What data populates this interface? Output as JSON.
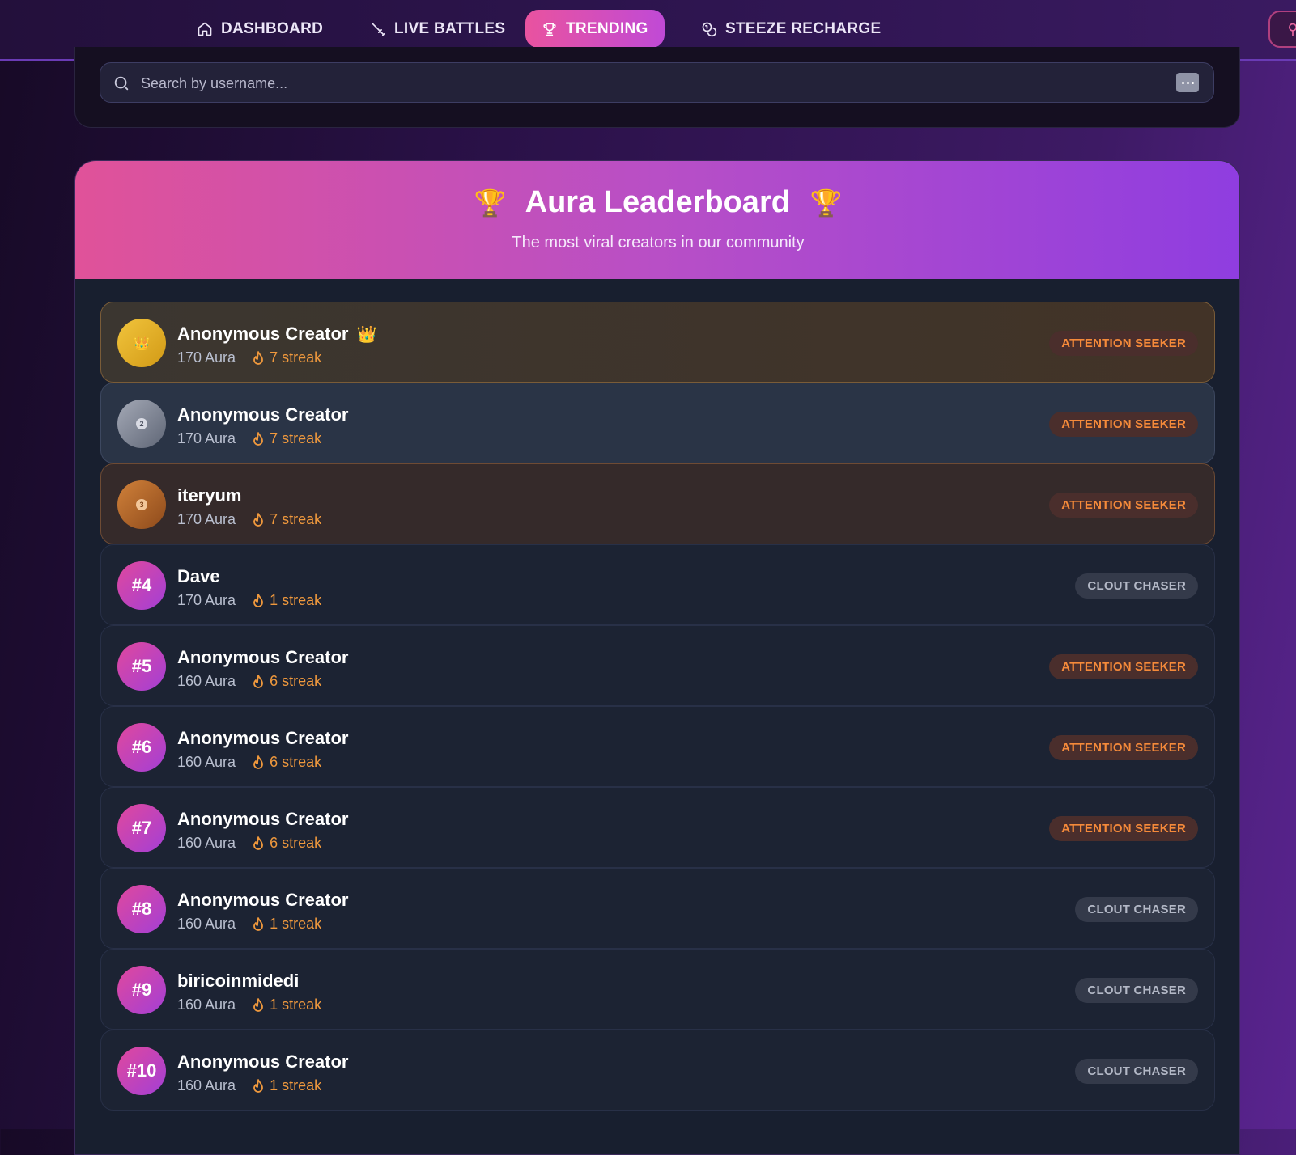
{
  "nav": {
    "items": [
      {
        "label": "DASHBOARD",
        "icon": "home-icon"
      },
      {
        "label": "LIVE BATTLES",
        "icon": "sword-icon"
      },
      {
        "label": "TRENDING",
        "icon": "trophy-icon",
        "active": true
      },
      {
        "label": "STEEZE RECHARGE",
        "icon": "coins-icon"
      }
    ]
  },
  "search": {
    "placeholder": "Search by username...",
    "value": ""
  },
  "leaderboard": {
    "title": "Aura Leaderboard",
    "trophy": "🏆",
    "subtitle": "The most viral creators in our community",
    "colors": {
      "header_start": "#e05299",
      "header_end": "#8f3de0",
      "attention_badge": "#f58a3a",
      "clout_badge": "#b3b8c6",
      "streak": "#f0993d"
    },
    "entries": [
      {
        "rank_label": "👑",
        "rank": 1,
        "name": "Anonymous Creator",
        "crown": "👑",
        "aura": "170 Aura",
        "streak": "7 streak",
        "badge": "ATTENTION SEEKER"
      },
      {
        "rank_label": "2",
        "rank": 2,
        "name": "Anonymous Creator",
        "aura": "170 Aura",
        "streak": "7 streak",
        "badge": "ATTENTION SEEKER"
      },
      {
        "rank_label": "3",
        "rank": 3,
        "name": "iteryum",
        "aura": "170 Aura",
        "streak": "7 streak",
        "badge": "ATTENTION SEEKER"
      },
      {
        "rank_label": "#4",
        "rank": 4,
        "name": "Dave",
        "aura": "170 Aura",
        "streak": "1 streak",
        "badge": "CLOUT CHASER"
      },
      {
        "rank_label": "#5",
        "rank": 5,
        "name": "Anonymous Creator",
        "aura": "160 Aura",
        "streak": "6 streak",
        "badge": "ATTENTION SEEKER"
      },
      {
        "rank_label": "#6",
        "rank": 6,
        "name": "Anonymous Creator",
        "aura": "160 Aura",
        "streak": "6 streak",
        "badge": "ATTENTION SEEKER"
      },
      {
        "rank_label": "#7",
        "rank": 7,
        "name": "Anonymous Creator",
        "aura": "160 Aura",
        "streak": "6 streak",
        "badge": "ATTENTION SEEKER"
      },
      {
        "rank_label": "#8",
        "rank": 8,
        "name": "Anonymous Creator",
        "aura": "160 Aura",
        "streak": "1 streak",
        "badge": "CLOUT CHASER"
      },
      {
        "rank_label": "#9",
        "rank": 9,
        "name": "biricoinmidedi",
        "aura": "160 Aura",
        "streak": "1 streak",
        "badge": "CLOUT CHASER"
      },
      {
        "rank_label": "#10",
        "rank": 10,
        "name": "Anonymous Creator",
        "aura": "160 Aura",
        "streak": "1 streak",
        "badge": "CLOUT CHASER"
      }
    ]
  }
}
